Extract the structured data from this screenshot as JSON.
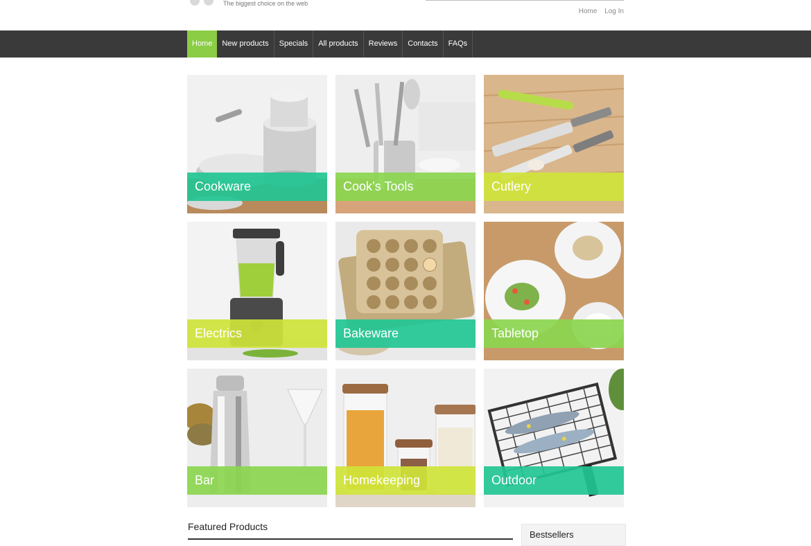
{
  "header": {
    "tagline": "The biggest choice on the web",
    "toplinks": [
      "Home",
      "Log In"
    ]
  },
  "nav": {
    "items": [
      {
        "label": "Home",
        "active": true
      },
      {
        "label": "New products",
        "active": false
      },
      {
        "label": "Specials",
        "active": false
      },
      {
        "label": "All products",
        "active": false
      },
      {
        "label": "Reviews",
        "active": false
      },
      {
        "label": "Contacts",
        "active": false
      },
      {
        "label": "FAQs",
        "active": false
      }
    ],
    "active_color": "#8bcd45",
    "bar_color": "#3a3a3a"
  },
  "categories": [
    {
      "label": "Cookware",
      "band_color": "#22c694"
    },
    {
      "label": "Cook’s Tools",
      "band_color": "#8bd64f"
    },
    {
      "label": "Cutlery",
      "band_color": "#cfe43a"
    },
    {
      "label": "Electrics",
      "band_color": "#cfe43a"
    },
    {
      "label": "Bakeware",
      "band_color": "#22c694"
    },
    {
      "label": "Tabletop",
      "band_color": "#8bd64f"
    },
    {
      "label": "Bar",
      "band_color": "#8bd64f"
    },
    {
      "label": "Homekeeping",
      "band_color": "#cfe43a"
    },
    {
      "label": "Outdoor",
      "band_color": "#22c694"
    }
  ],
  "sections": {
    "featured_title": "Featured Products",
    "bestsellers_title": "Bestsellers"
  }
}
